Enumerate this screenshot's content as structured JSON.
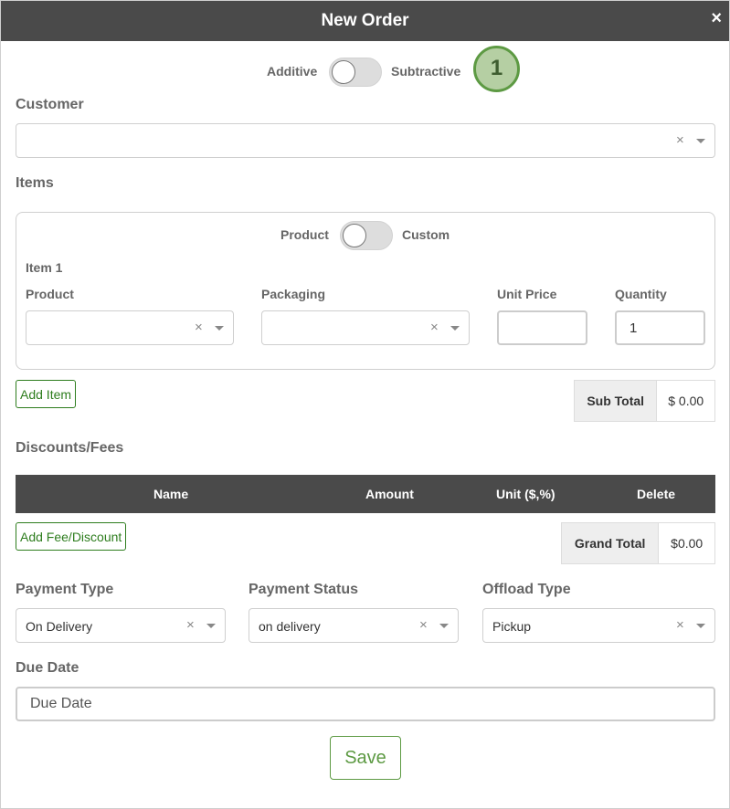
{
  "modal": {
    "title": "New Order",
    "close_icon": "×"
  },
  "mode_toggle": {
    "left_label": "Additive",
    "right_label": "Subtractive",
    "checked": false
  },
  "step_badge": "1",
  "customer": {
    "label": "Customer",
    "value": "",
    "clear_icon": "×"
  },
  "items": {
    "label": "Items",
    "type_toggle": {
      "left_label": "Product",
      "right_label": "Custom",
      "checked": false
    },
    "rows": [
      {
        "title": "Item 1",
        "product_label": "Product",
        "product_value": "",
        "packaging_label": "Packaging",
        "packaging_value": "",
        "unit_price_label": "Unit Price",
        "unit_price_value": "",
        "quantity_label": "Quantity",
        "quantity_value": "1"
      }
    ],
    "add_button": "Add Item"
  },
  "sub_total": {
    "label": "Sub Total",
    "value": "$ 0.00"
  },
  "discounts": {
    "label": "Discounts/Fees",
    "columns": [
      "Name",
      "Amount",
      "Unit ($,%)",
      "Delete"
    ],
    "rows": [],
    "add_button": "Add Fee/Discount"
  },
  "grand_total": {
    "label": "Grand Total",
    "value": "$0.00"
  },
  "payment_type": {
    "label": "Payment Type",
    "value": "On Delivery"
  },
  "payment_status": {
    "label": "Payment Status",
    "value": "on delivery"
  },
  "offload_type": {
    "label": "Offload Type",
    "value": "Pickup"
  },
  "due_date": {
    "label": "Due Date",
    "placeholder": "Due Date",
    "value": ""
  },
  "save_button": "Save",
  "colors": {
    "header": "#4a4a4a",
    "accent": "#5d9a43",
    "button_green": "#2e7d1e"
  }
}
